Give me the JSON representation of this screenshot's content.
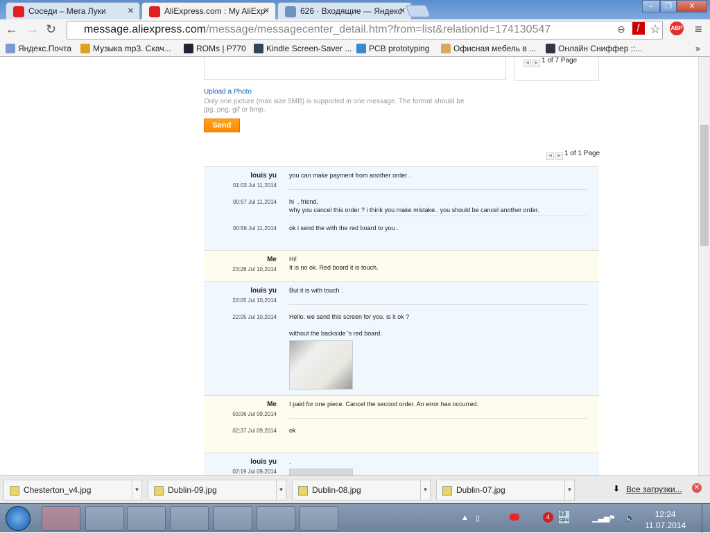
{
  "browser": {
    "tabs": [
      {
        "label": "Соседи – Мега Луки",
        "icon": "mega-icon",
        "color": "#e02020"
      },
      {
        "label": "AliExpress.com : My AliExp",
        "icon": "cart-icon",
        "color": "#e02020"
      },
      {
        "label": "626 · Входящие — Яндекс",
        "icon": "mail-icon",
        "color": "#7090c0"
      }
    ],
    "url_host": "message.aliexpress.com",
    "url_path": "/message/messagecenter_detail.htm?from=list&relationId=174130547",
    "bookmarks": [
      {
        "label": "Яндекс.Почта",
        "color": "#7a9ad0"
      },
      {
        "label": "Музыка mp3. Скач...",
        "color": "#e0a020"
      },
      {
        "label": "ROMs | P770",
        "color": "#223"
      },
      {
        "label": "Kindle Screen-Saver ...",
        "color": "#345"
      },
      {
        "label": "PCB prototyping",
        "color": "#3a8ad0"
      },
      {
        "label": "Офисная мебель в ...",
        "color": "#d8a860"
      },
      {
        "label": "Онлайн Сниффер ::...",
        "color": "#334"
      }
    ],
    "more": "»"
  },
  "composer": {
    "pager_top": "1 of 7 Page",
    "upload_label": "Upload a Photo",
    "hint": "Only one picture (max size 5MB) is supported in one message. The format should be jpg, png, gif or bmp.",
    "send_label": "Send"
  },
  "pager": "1 of 1 Page",
  "conversation": [
    {
      "sender": "louis yu",
      "side": "them",
      "messages": [
        {
          "time": "01:03 Jul 11,2014",
          "text": "you can make payment from another order ."
        },
        {
          "time": "00:57 Jul 11,2014",
          "text": "hi  . friend,\nwhy you cancel this order ? i think you make mistake.. you should be cancel another order."
        },
        {
          "time": "00:56 Jul 11,2014",
          "text": "ok i send the with the red board to you ."
        }
      ]
    },
    {
      "sender": "Me",
      "side": "me",
      "messages": [
        {
          "time": "23:28 Jul 10,2014",
          "text": "Hi!\nIt is no ok. Red board it is touch."
        }
      ]
    },
    {
      "sender": "louis yu",
      "side": "them",
      "messages": [
        {
          "time": "22:05 Jul 10,2014",
          "text": "But it is with touch ."
        },
        {
          "time": "22:05 Jul 10,2014",
          "text": "Hello. we send this screen for you. is it ok ?\n\nwithout the backside 's red board.",
          "photo": true
        }
      ]
    },
    {
      "sender": "Me",
      "side": "me",
      "messages": [
        {
          "time": "03:06 Jul 09,2014",
          "text": "I paid for one piece. Cancel the second order. An error has occurred."
        },
        {
          "time": "02:37 Jul 09,2014",
          "text": "ok"
        }
      ]
    },
    {
      "sender": "louis yu",
      "side": "them",
      "messages": [
        {
          "time": "02:19 Jul 09,2014",
          "text": ".",
          "photo": true,
          "photo_style": "pcb"
        }
      ]
    }
  ],
  "downloads": {
    "items": [
      "Chesterton_v4.jpg",
      "Dublin-09.jpg",
      "Dublin-08.jpg",
      "Dublin-07.jpg"
    ],
    "all_label": "Все загрузки..."
  },
  "taskbar": {
    "time": "12:24",
    "date": "11.07.2014",
    "cpu": "63\ncpu",
    "badge": "4"
  }
}
